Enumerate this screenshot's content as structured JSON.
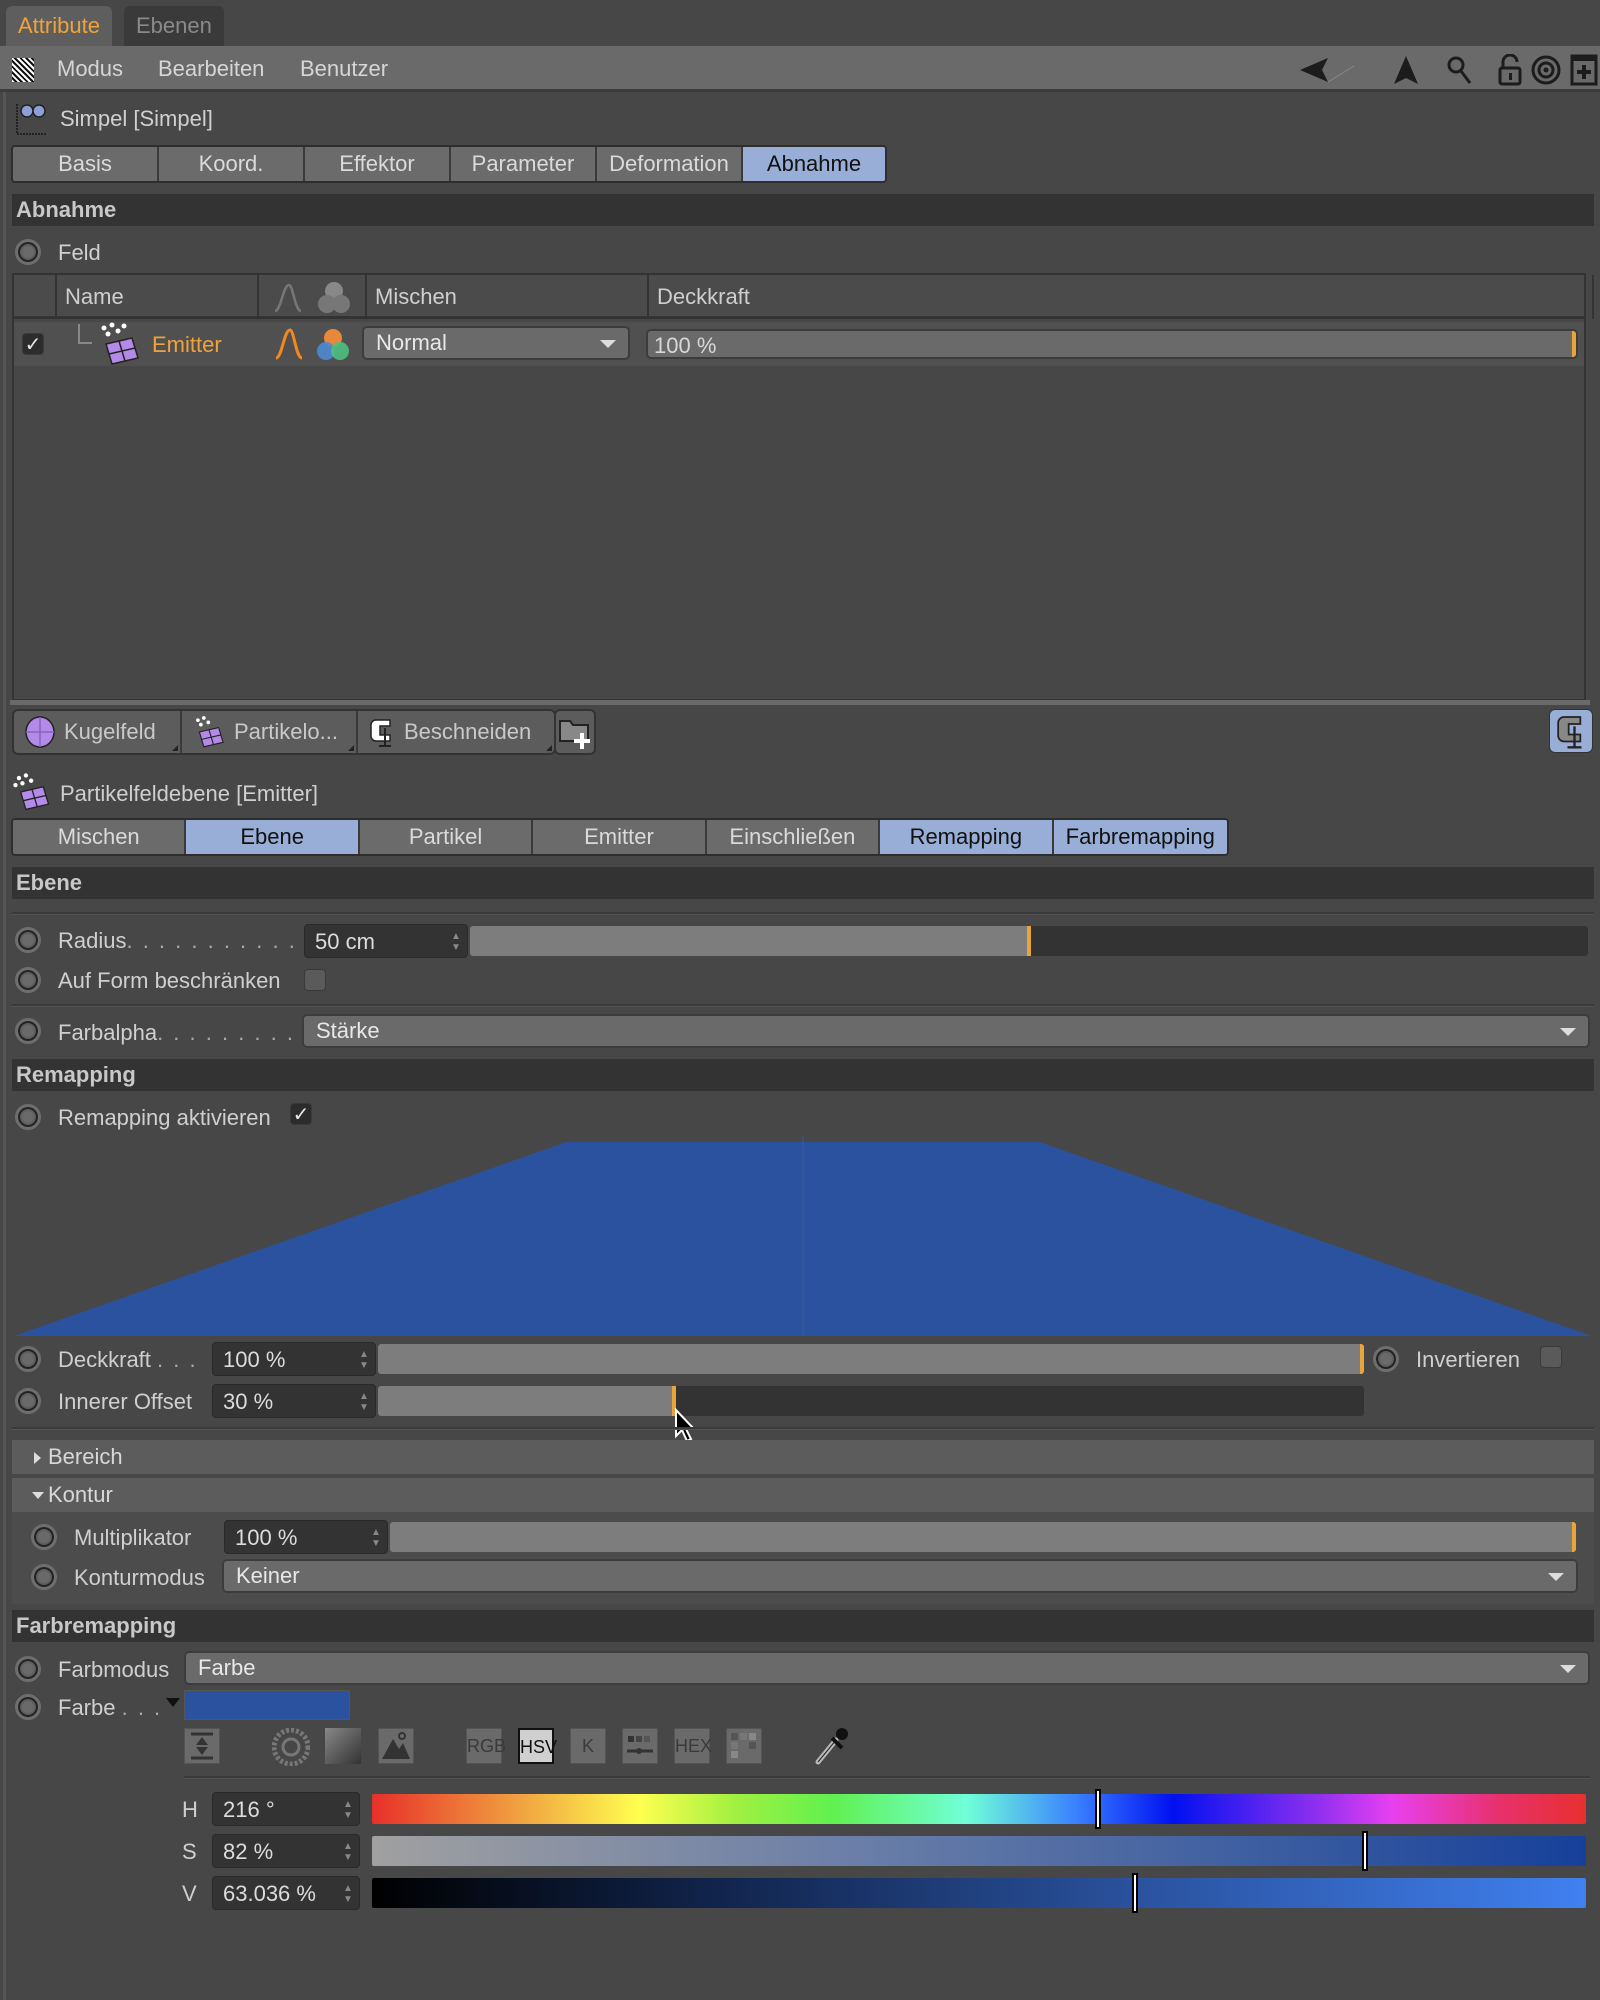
{
  "top_tabs": [
    {
      "label": "Attribute",
      "active": true
    },
    {
      "label": "Ebenen",
      "active": false
    }
  ],
  "menu": {
    "items": [
      "Modus",
      "Bearbeiten",
      "Benutzer"
    ],
    "icons": [
      "back-arrow-icon",
      "up-arrow-icon",
      "search-icon",
      "lock-icon",
      "target-icon",
      "new-panel-icon"
    ]
  },
  "object": {
    "title": "Simpel [Simpel]",
    "tabs": [
      {
        "label": "Basis",
        "active": false
      },
      {
        "label": "Koord.",
        "active": false
      },
      {
        "label": "Effektor",
        "active": false
      },
      {
        "label": "Parameter",
        "active": false
      },
      {
        "label": "Deformation",
        "active": false
      },
      {
        "label": "Abnahme",
        "active": true
      }
    ]
  },
  "abnahme": {
    "section_title": "Abnahme",
    "feld_label": "Feld",
    "columns": {
      "name": "Name",
      "mischen": "Mischen",
      "deckkraft": "Deckkraft"
    },
    "rows": [
      {
        "enabled": true,
        "name": "Emitter",
        "blend": "Normal",
        "opacity": "100 %",
        "opacity_value": 1.0
      }
    ]
  },
  "layer_bar": {
    "items": [
      {
        "label": "Kugelfeld",
        "icon": "sphere-field-icon"
      },
      {
        "label": "Partikelo...",
        "icon": "particle-object-icon"
      },
      {
        "label": "Beschneiden",
        "icon": "clamp-icon"
      }
    ],
    "add_folder_icon": "add-folder-icon",
    "right_icon": "clamp-icon"
  },
  "layer": {
    "title": "Partikelfeldebene [Emitter]",
    "tabs": [
      {
        "label": "Mischen",
        "active": false
      },
      {
        "label": "Ebene",
        "active": true
      },
      {
        "label": "Partikel",
        "active": false
      },
      {
        "label": "Emitter",
        "active": false
      },
      {
        "label": "Einschließen",
        "active": false
      },
      {
        "label": "Remapping",
        "active": true
      },
      {
        "label": "Farbremapping",
        "active": true
      }
    ]
  },
  "ebene": {
    "section_title": "Ebene",
    "radius": {
      "label": "Radius",
      "dots": ". . . . . . . . . . . . . .",
      "value": "50 cm",
      "slider_fraction": 0.5
    },
    "auf_form": {
      "label": "Auf Form beschränken",
      "checked": false
    },
    "farbalpha": {
      "label": "Farbalpha",
      "dots": ". . . . . . . . . . . .",
      "value": "Stärke"
    }
  },
  "remapping": {
    "section_title": "Remapping",
    "activate_label": "Remapping aktivieren",
    "activate_checked": true,
    "curve_color": "#2a529e",
    "curve_points": [
      [
        0,
        0
      ],
      [
        0.35,
        1
      ],
      [
        0.65,
        1
      ],
      [
        1,
        0
      ]
    ],
    "deckkraft": {
      "label": "Deckkraft",
      "dots": ". . .",
      "value": "100 %",
      "fraction": 1.0
    },
    "invertieren": {
      "label": "Invertieren",
      "checked": false
    },
    "innerer_offset": {
      "label": "Innerer Offset",
      "value": "30 %",
      "fraction": 0.3
    }
  },
  "bereich": {
    "label": "Bereich",
    "expanded": false
  },
  "kontur": {
    "label": "Kontur",
    "expanded": true,
    "multiplikator": {
      "label": "Multiplikator",
      "value": "100 %",
      "fraction": 1.0
    },
    "konturmodus": {
      "label": "Konturmodus",
      "value": "Keiner"
    }
  },
  "farbremapping": {
    "section_title": "Farbremapping",
    "farbmodus": {
      "label": "Farbmodus",
      "value": "Farbe"
    },
    "farbe": {
      "label": "Farbe",
      "dots": ". . .",
      "color": "#2a529e"
    },
    "picker_modes": [
      "RGB",
      "HSV",
      "K",
      "slider-mode",
      "HEX",
      "swatches"
    ],
    "active_mode": "HSV",
    "h": {
      "label": "H",
      "value": "216 °",
      "fraction": 0.6
    },
    "s": {
      "label": "S",
      "value": "82 %",
      "fraction": 0.82
    },
    "v": {
      "label": "V",
      "value": "63.036 %",
      "fraction": 0.63036
    }
  }
}
